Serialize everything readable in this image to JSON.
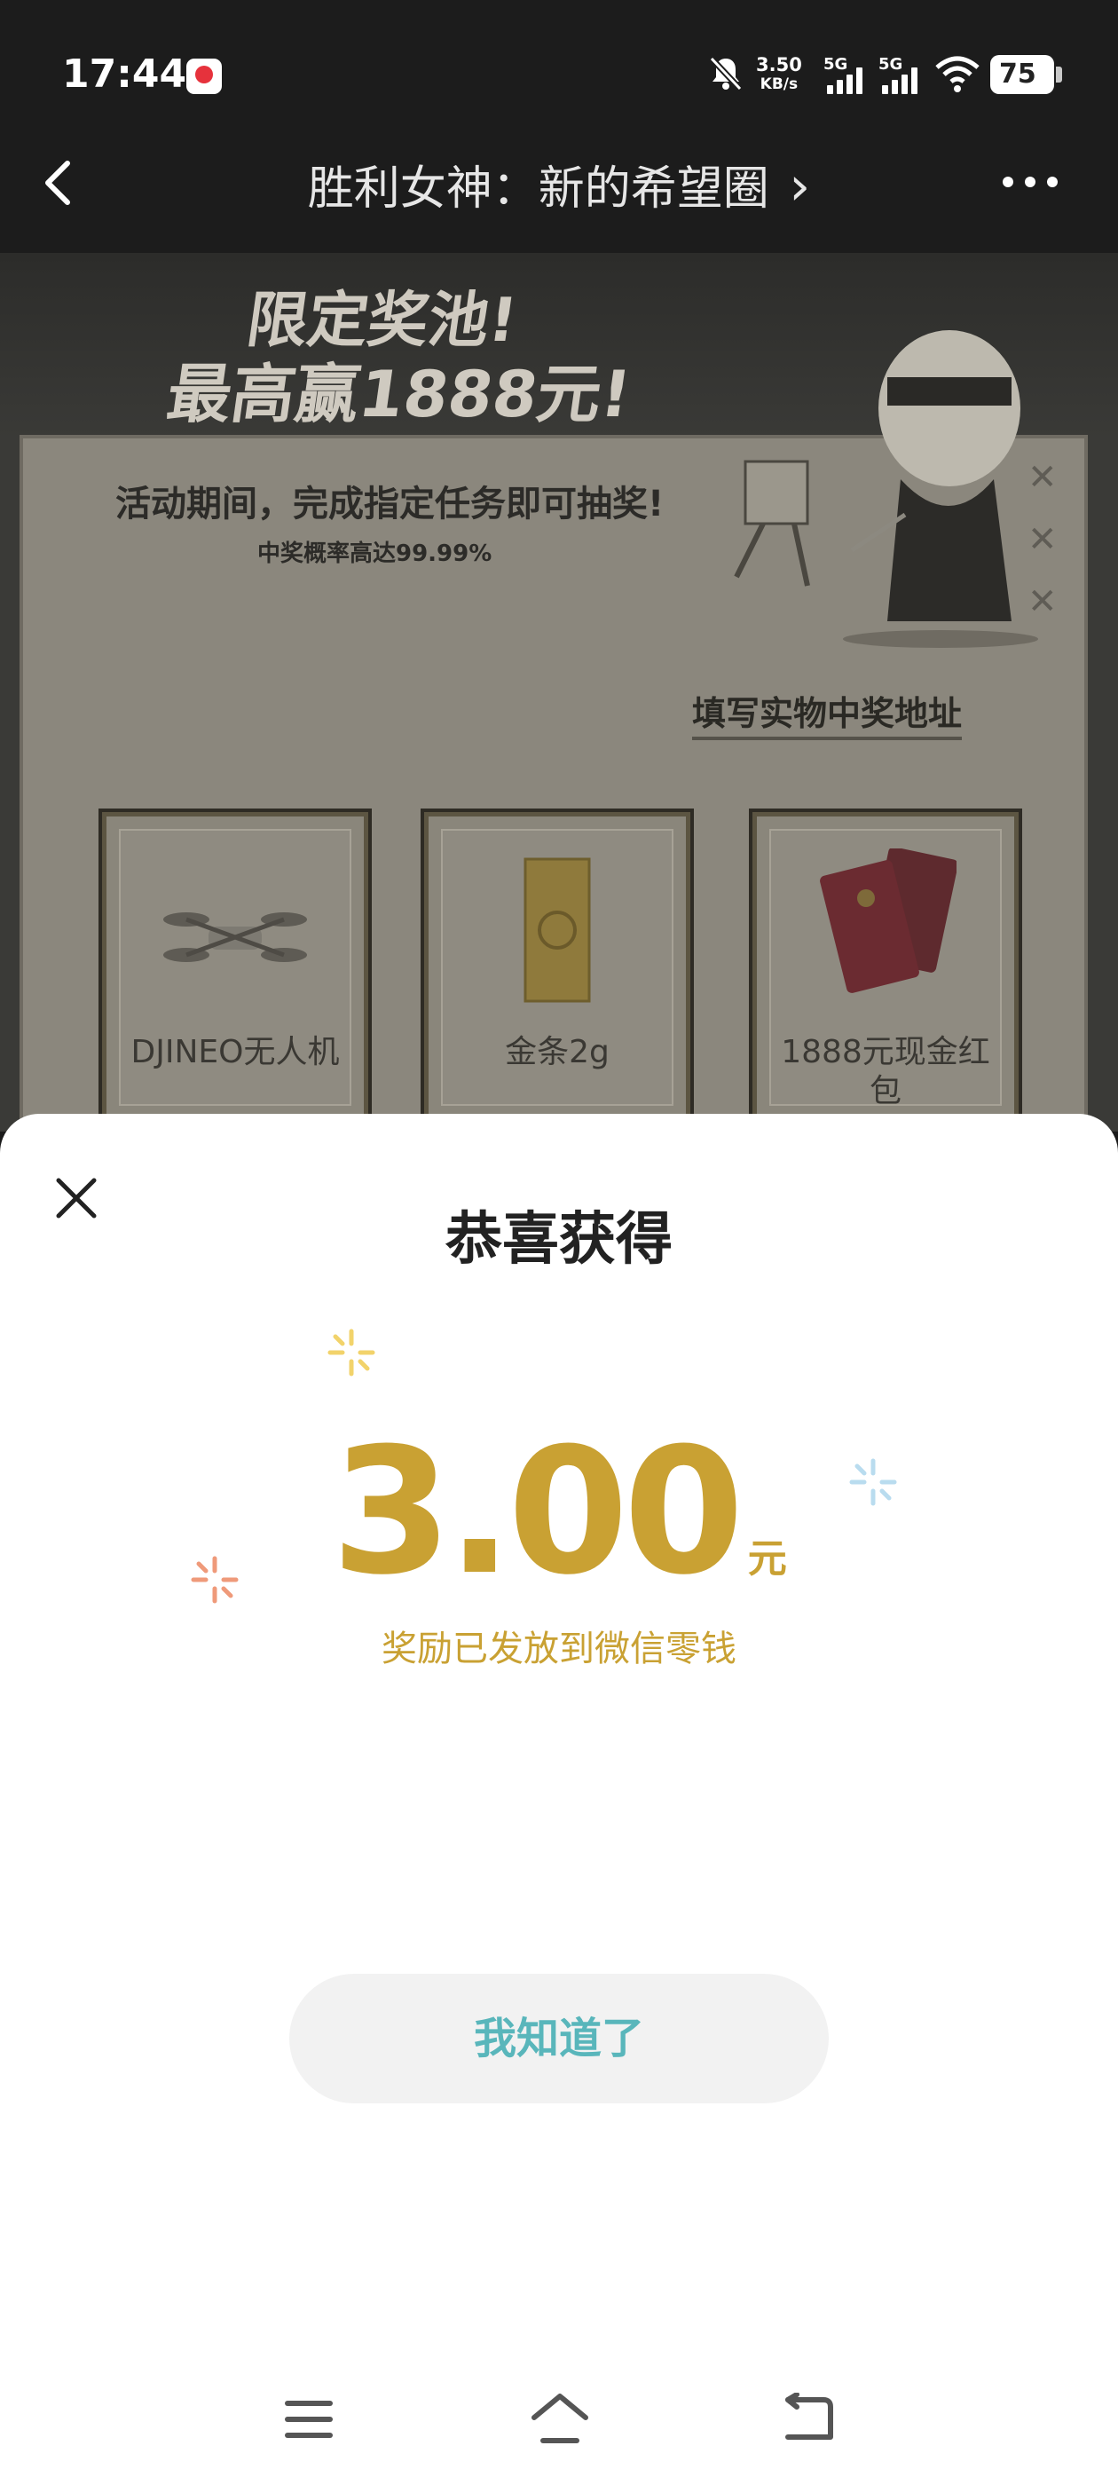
{
  "status_bar": {
    "time": "17:44",
    "app_icon": "dianping-icon",
    "net_speed_value": "3.50",
    "net_speed_unit": "KB/s",
    "signal_1_label": "5G",
    "signal_2_label": "5G",
    "battery": "75"
  },
  "nav": {
    "title": "胜利女神：新的希望圈",
    "title_chevron": "›"
  },
  "event": {
    "banner_line1": "限定奖池!",
    "banner_line2": "最高赢1888元!",
    "description": "活动期间，完成指定任务即可抽奖!",
    "probability": "中奖概率高达99.99%",
    "address_link": "填写实物中奖地址",
    "prizes": [
      {
        "name": "DJINEO无人机",
        "icon": "drone-icon"
      },
      {
        "name": "金条2g",
        "icon": "gold-bar-icon"
      },
      {
        "name": "1888元现金红包",
        "icon": "red-envelope-icon"
      }
    ]
  },
  "modal": {
    "title": "恭喜获得",
    "amount": "3.00",
    "unit": "元",
    "note": "奖励已发放到微信零钱",
    "confirm": "我知道了"
  },
  "colors": {
    "gold": "#c9a133",
    "button_text": "#59b6bb",
    "sparkle_yellow": "#f2d36b",
    "sparkle_blue": "#b9dcef",
    "sparkle_orange": "#ef9a7a"
  }
}
